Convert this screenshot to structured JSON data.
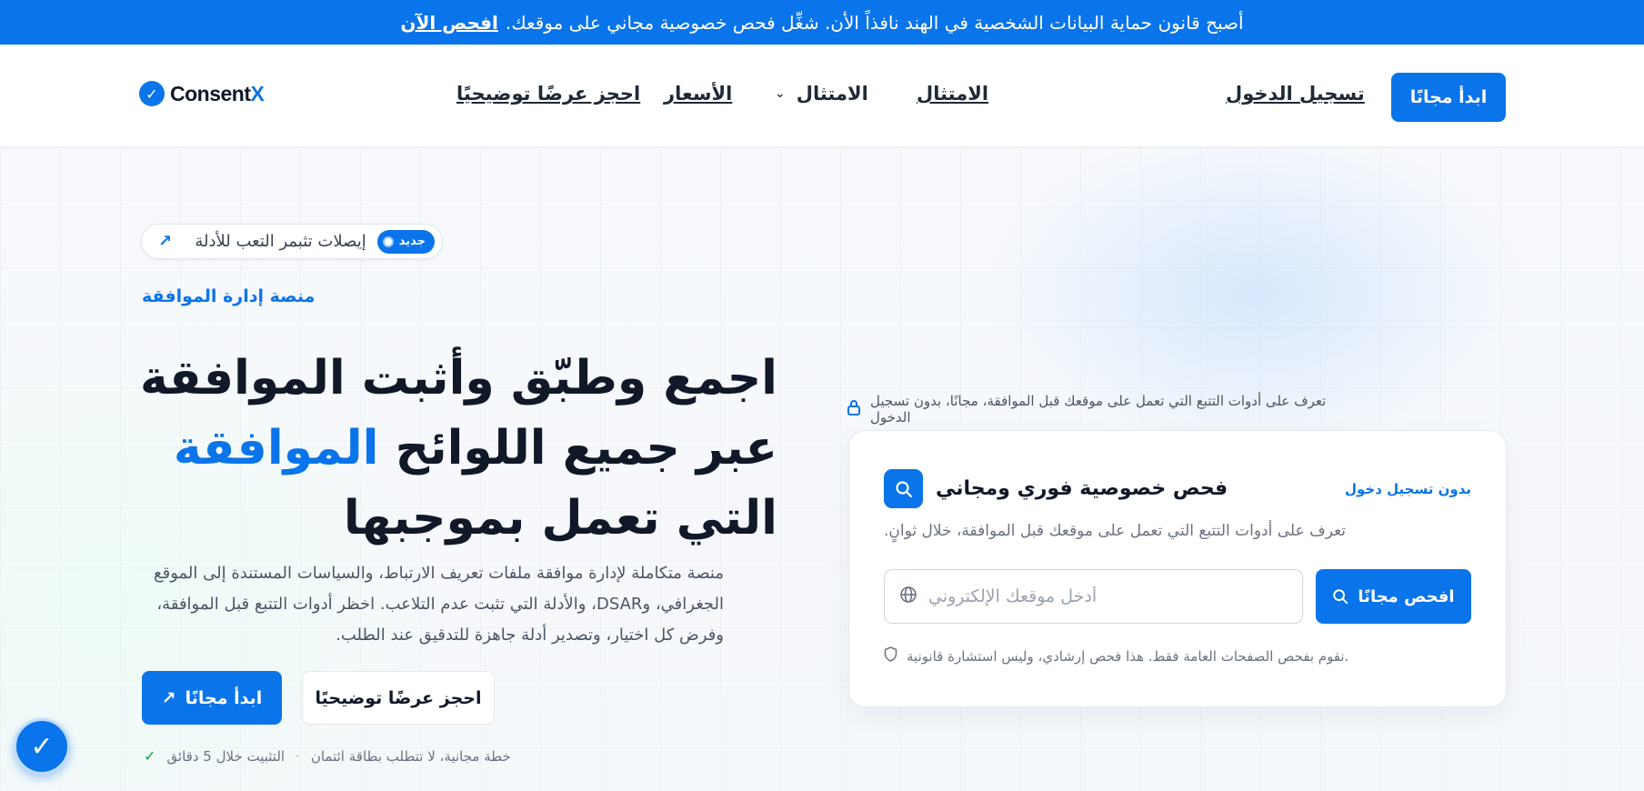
{
  "announcement": {
    "text": "أصبح قانون حماية البيانات الشخصية في الهند نافذاً الأن. شغِّل فحص خصوصية مجاني على موقعك.",
    "link": "افحص الآن"
  },
  "nav": {
    "logo": {
      "name": "Consent",
      "accent": "X"
    },
    "links": {
      "demo": "احجز عرضًا توضيحيًا",
      "pricing": "الأسعار",
      "compliance_dropdown": "الامتثال",
      "compliance": "الامتثال"
    },
    "login": "تسجيل الدخول",
    "cta": "ابدأ مجانًا"
  },
  "hero": {
    "pill": {
      "badge": "جديد",
      "text": "إيصلات تثبمر التعب للأدلة"
    },
    "eyebrow": "منصة إدارة الموافقة",
    "headline_before": "اجمع وطبّق وأثبت الموافقة عبر جميع اللوائح ",
    "headline_highlight": "الموافقة",
    "headline_after": " التي تعمل بموجبها",
    "description": "منصة متكاملة لإدارة موافقة ملفات تعريف الارتباط، والسياسات المستندة إلى الموقع الجغرافي، وDSAR، والأدلة التي تثبت عدم التلاعب. اخظر أدوات التتبع قبل الموافقة، وفرض كل اختيار، وتصدير أدلة جاهزة للتدقيق عند الطلب.",
    "primary_cta": "ابدأ مجانًا",
    "secondary_cta": "احجز عرضًا توضيحيًا",
    "footnote": {
      "install": "التثبيت خلال 5 دقائق",
      "free": "خطة مجانية، لا تتطلب بطاقة ائتمان"
    }
  },
  "scan_card": {
    "caption": "تعرف على أدوات التتبع التي تعمل على موقعك قبل الموافقة، مجانًا، بدون تسجيل الدخول",
    "title": "فحص خصوصية فوري ومجاني",
    "tag": "بدون تسجيل دخول",
    "subtitle": "تعرف على أدوات التتبع التي تعمل على موقعك قبل الموافقة، خلال ثوانٍ.",
    "input_placeholder": "أدخل موقعك الإلكتروني",
    "input_value": "",
    "scan_button": "افحص مجانًا",
    "disclaimer": "نقوم بفحص الصفحات العامة فقط. هذا فحص إرشادي، وليس استشارة قانونية."
  },
  "icons": {
    "search": "search-icon",
    "globe": "globe-icon",
    "lock": "lock-icon",
    "shield": "shield-icon",
    "arrow": "arrow-up-right-icon",
    "check": "check-icon",
    "chevron": "chevron-down-icon",
    "help": "checkmark-badge-icon"
  },
  "colors": {
    "brand": "#0a74ea",
    "success": "#16a34a"
  }
}
